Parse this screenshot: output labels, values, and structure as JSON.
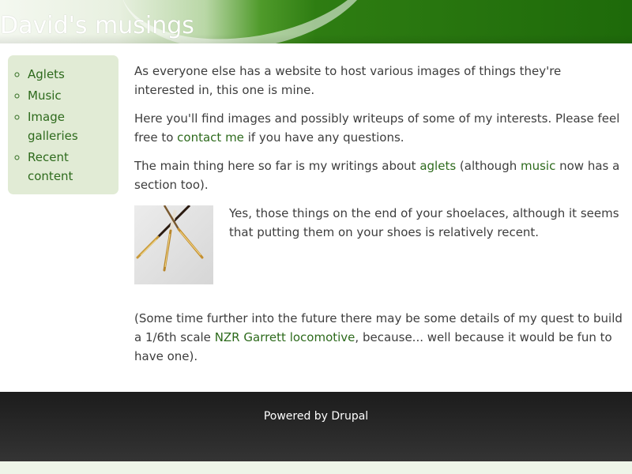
{
  "header": {
    "site_name": "David's musings"
  },
  "sidebar": {
    "items": [
      {
        "label": "Aglets"
      },
      {
        "label": "Music"
      },
      {
        "label": "Image galleries"
      },
      {
        "label": "Recent content"
      }
    ]
  },
  "content": {
    "p1": "As everyone else has a website to host various images of things they're interested in, this one is mine.",
    "p2_before": "Here you'll find images and possibly writeups of some of my interests. Please feel free to ",
    "p2_link": "contact me",
    "p2_after": " if you have any questions.",
    "p3_before": " The main thing here so far is my writings about ",
    "p3_link1": "aglets",
    "p3_mid": " (although ",
    "p3_link2": "music",
    "p3_after": " now has a section too).",
    "feature_text": "Yes, those things on the end of your shoelaces, although it seems that putting them on your shoes is relatively recent.",
    "p5_before": "(Some time further into the future there may be some details of my quest to build a 1/6th scale ",
    "p5_link": "NZR Garrett locomotive",
    "p5_after": ", because... well because it would be fun to have one)."
  },
  "footer": {
    "text": "Powered by Drupal"
  },
  "colors": {
    "link": "#2d6a1c",
    "header_green": "#2e7d12",
    "sidebar_bg": "#e1ebd5",
    "footer_bg": "#2a2a2a"
  }
}
